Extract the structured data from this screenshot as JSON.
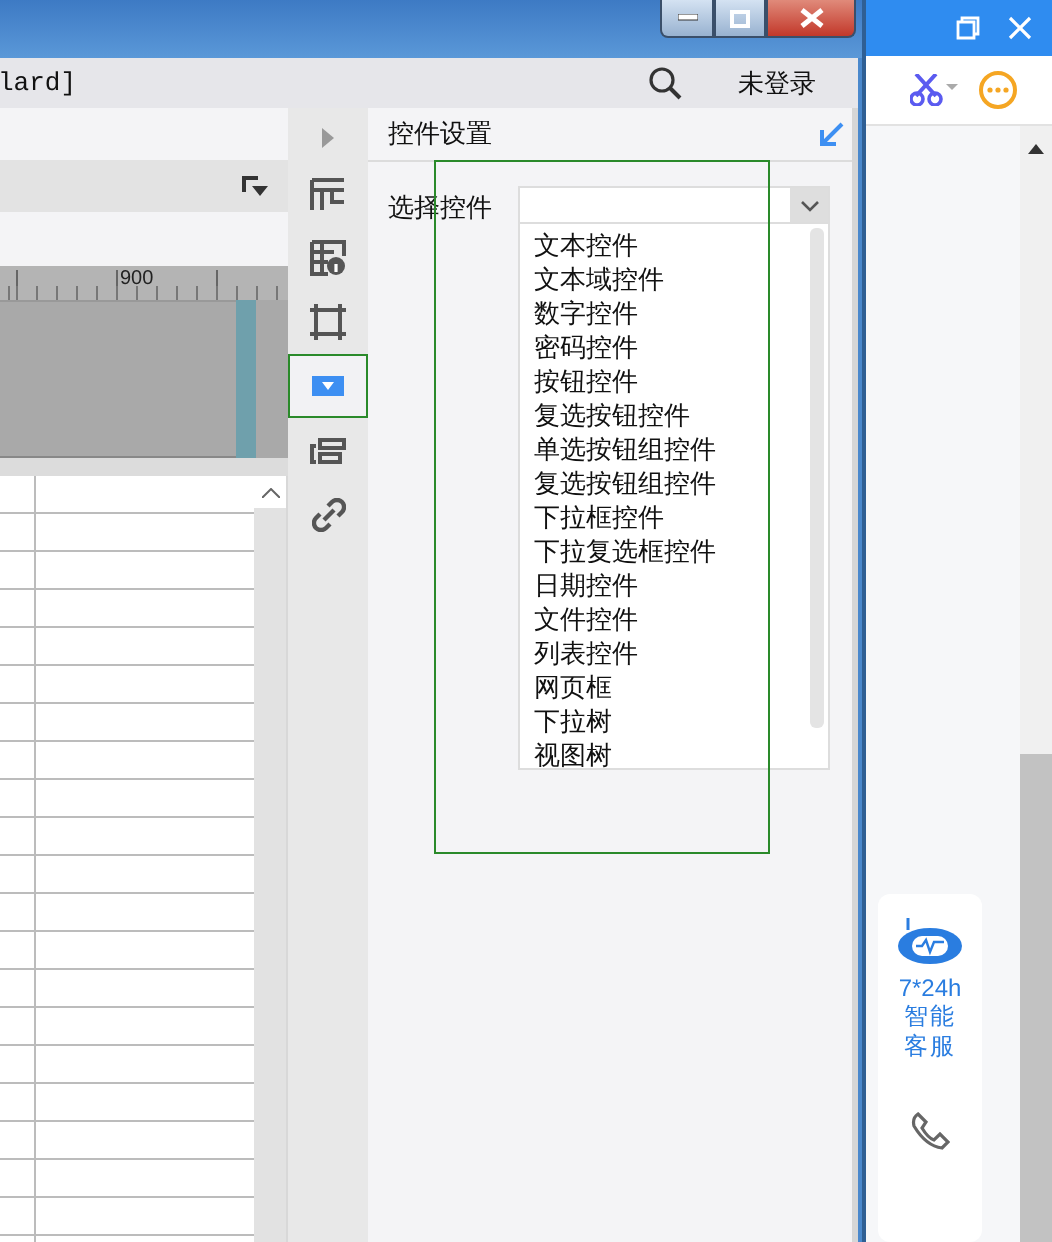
{
  "menubar": {
    "title": "lard]",
    "user": "未登录"
  },
  "ruler": {
    "label": "900"
  },
  "side_tools": [
    {
      "kind": "expand",
      "selected": false
    },
    {
      "kind": "grid",
      "selected": false
    },
    {
      "kind": "info",
      "selected": false
    },
    {
      "kind": "frame",
      "selected": false
    },
    {
      "kind": "dropdown",
      "selected": true
    },
    {
      "kind": "layout",
      "selected": false
    },
    {
      "kind": "link",
      "selected": false
    }
  ],
  "panel": {
    "title": "控件设置",
    "field_label": "选择控件",
    "options": [
      "文本控件",
      "文本域控件",
      "数字控件",
      "密码控件",
      "按钮控件",
      "复选按钮控件",
      "单选按钮组控件",
      "复选按钮组控件",
      "下拉框控件",
      "下拉复选框控件",
      "日期控件",
      "文件控件",
      "列表控件",
      "网页框",
      "下拉树",
      "视图树"
    ]
  },
  "service": {
    "hours": "7*24h",
    "label": "智能客服"
  }
}
